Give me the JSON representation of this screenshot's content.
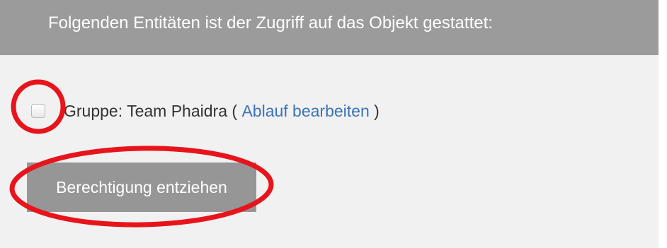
{
  "header": {
    "title": "Folgenden Entitäten ist der Zugriff auf das Objekt gestattet:"
  },
  "entities": [
    {
      "label": "Gruppe: Team Phaidra",
      "open_paren": "(",
      "edit_link": "Ablauf bearbeiten",
      "close_paren": ")",
      "checked": false
    }
  ],
  "actions": {
    "revoke_label": "Berechtigung entziehen"
  },
  "colors": {
    "header_bg": "#9b9b9b",
    "panel_bg": "#f1f1f1",
    "link": "#3b73b9",
    "button_bg": "#969696",
    "annotation": "#e8141c"
  }
}
